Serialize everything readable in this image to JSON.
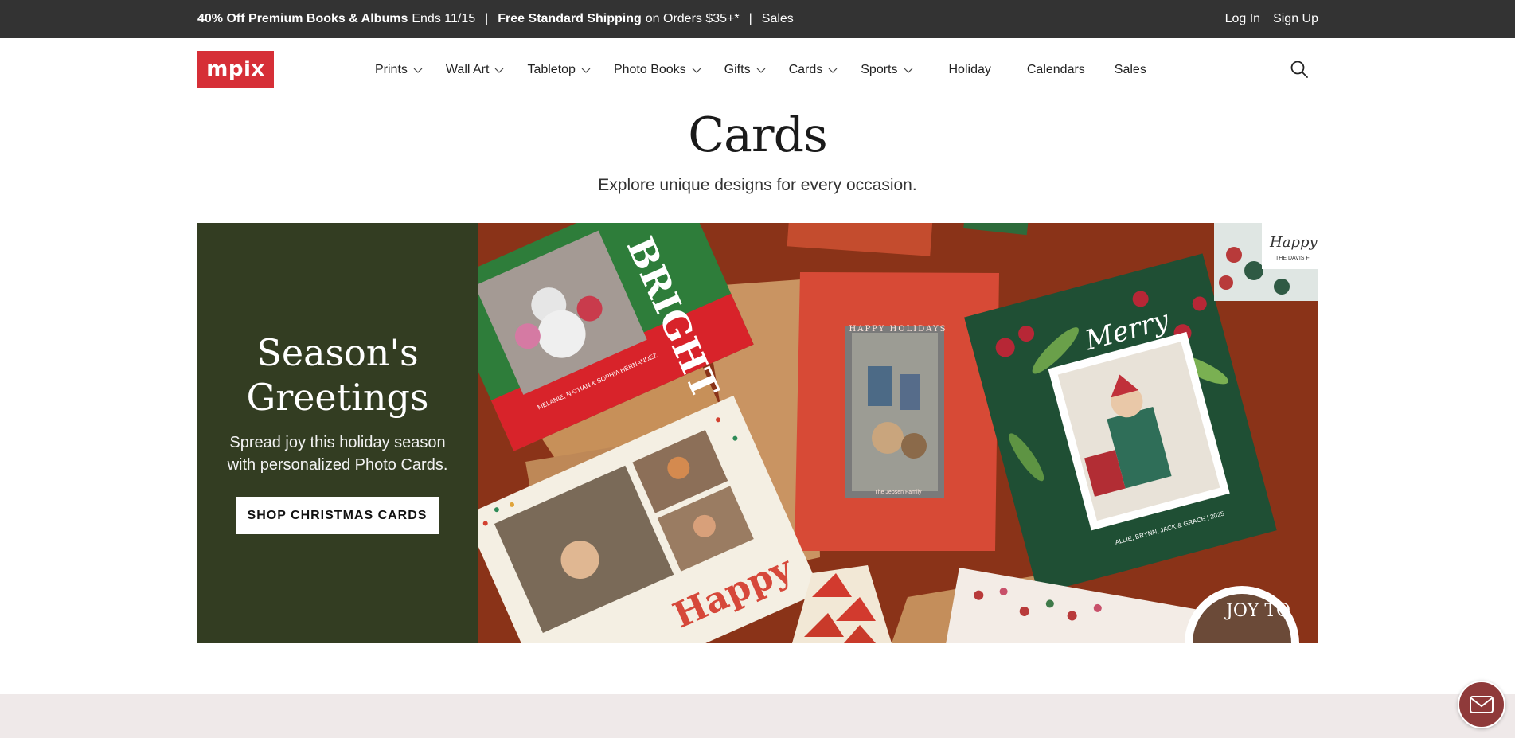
{
  "promo": {
    "offer_bold": "40% Off Premium Books & Albums",
    "offer_rest": "Ends 11/15",
    "separator": "|",
    "shipping_bold": "Free Standard Shipping",
    "shipping_rest": "on Orders $35+*",
    "sales_link": "Sales",
    "login": "Log In",
    "signup": "Sign Up"
  },
  "header": {
    "logo": "mpix",
    "nav": [
      {
        "label": "Prints",
        "has_dropdown": true
      },
      {
        "label": "Wall Art",
        "has_dropdown": true
      },
      {
        "label": "Tabletop",
        "has_dropdown": true
      },
      {
        "label": "Photo Books",
        "has_dropdown": true
      },
      {
        "label": "Gifts",
        "has_dropdown": true
      },
      {
        "label": "Cards",
        "has_dropdown": true
      },
      {
        "label": "Sports",
        "has_dropdown": true
      },
      {
        "label": "Holiday",
        "has_dropdown": false
      },
      {
        "label": "Calendars",
        "has_dropdown": false
      },
      {
        "label": "Sales",
        "has_dropdown": false
      }
    ],
    "search_icon": "search-icon"
  },
  "page": {
    "title": "Cards",
    "subtitle": "Explore unique designs for every occasion."
  },
  "hero": {
    "heading_line1": "Season's",
    "heading_line2": "Greetings",
    "text_line1": "Spread joy this holiday season",
    "text_line2": "with personalized Photo Cards.",
    "cta": "SHOP CHRISTMAS CARDS",
    "card_texts": {
      "bright": "BRIGHT",
      "happy_holidays": "HAPPY HOLIDAYS",
      "jepsen": "The Jepsen Family",
      "merry": "Merry",
      "happy": "Happy",
      "joy": "JOY TO",
      "davis": "THE DAVIS F",
      "happy_corner": "Happy",
      "allie": "ALLIE, BRYNN, JACK & GRACE | 2025",
      "melanie": "MELANIE, NATHAN & SOPHIA HERNANDEZ"
    }
  },
  "colors": {
    "promo_bg": "#333333",
    "brand_red": "#d62f37",
    "hero_panel": "#333d22",
    "hero_bg": "#8a3318",
    "chat": "#8f3a3a",
    "band": "#efe9e9"
  },
  "chat": {
    "icon": "mail-icon"
  }
}
